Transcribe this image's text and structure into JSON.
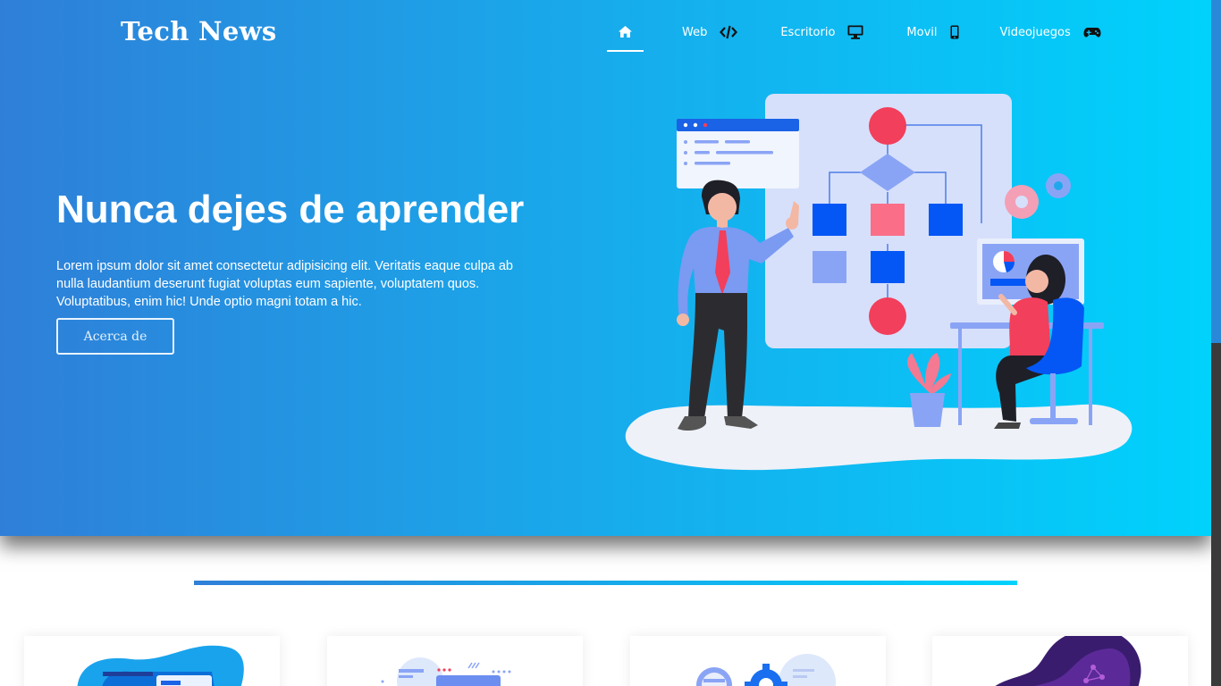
{
  "brand": {
    "title": "Tech News"
  },
  "nav": {
    "items": [
      {
        "label": "",
        "icon": "home-icon",
        "active": true
      },
      {
        "label": "Web",
        "icon": "code-icon"
      },
      {
        "label": "Escritorio",
        "icon": "desktop-icon"
      },
      {
        "label": "Movil",
        "icon": "mobile-icon"
      },
      {
        "label": "Videojuegos",
        "icon": "gamepad-icon"
      }
    ]
  },
  "hero": {
    "title": "Nunca dejes de aprender",
    "text": "Lorem ipsum dolor sit amet consectetur adipisicing elit. Veritatis eaque culpa ab nulla laudantium deserunt fugiat voluptas eum sapiente, voluptatem quos. Voluptatibus, enim hic! Unde optio magni totam a hic.",
    "button_label": "Acerca de"
  },
  "colors": {
    "gradient_start": "#2f7fd8",
    "gradient_end": "#00d2fc",
    "accent_red": "#f23f5b",
    "accent_blue": "#0457f5"
  }
}
